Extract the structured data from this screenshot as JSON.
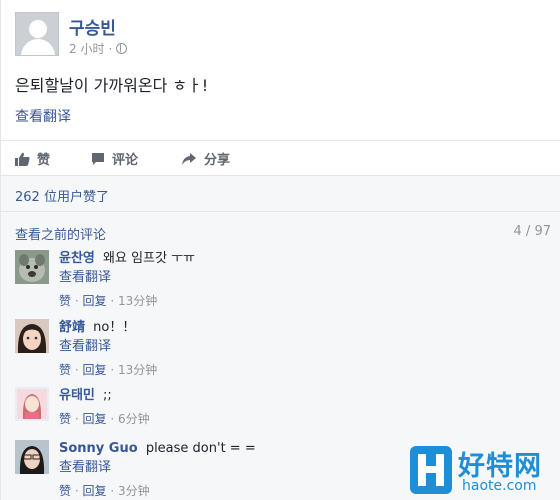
{
  "post": {
    "author": "구승빈",
    "time": "2 小时",
    "separator": "·",
    "text": "은퇴할날이 가까워온다 ㅎㅏ!",
    "see_translation": "查看翻译"
  },
  "actions": {
    "like": "赞",
    "comment": "评论",
    "share": "分享"
  },
  "likes": {
    "text": "262 位用户赞了"
  },
  "comments_section": {
    "view_previous": "查看之前的评论",
    "count": "4 / 97",
    "items": [
      {
        "name": "윤찬영",
        "text": "왜요 임프갓 ㅜㅠ",
        "translate": "查看翻译",
        "like": "赞",
        "reply": "回复",
        "time": "13分钟",
        "avatar_icon": "dog-photo-avatar"
      },
      {
        "name": "舒靖",
        "text": "no！！",
        "translate": "查看翻译",
        "like": "赞",
        "reply": "回复",
        "time": "13分钟",
        "avatar_icon": "girl-photo-avatar"
      },
      {
        "name": "유태민",
        "text": ";;",
        "translate": "",
        "like": "赞",
        "reply": "回复",
        "time": "6分钟",
        "avatar_icon": "girl-illustration-avatar"
      },
      {
        "name": "Sonny Guo",
        "text": "please don't = =",
        "translate": "查看翻译",
        "like": "赞",
        "reply": "回复",
        "time": "3分钟",
        "avatar_icon": "girl-photo-avatar"
      }
    ]
  },
  "footer_sep": "·",
  "watermark": {
    "cn": "好特网",
    "en": "haote.com"
  },
  "colors": {
    "link": "#365899",
    "muted": "#90949c",
    "watermark": "#1e8fd6"
  }
}
